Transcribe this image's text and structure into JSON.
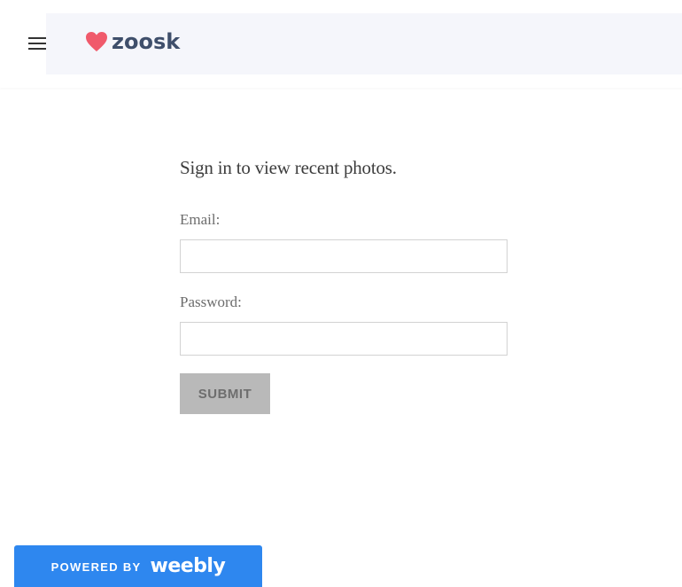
{
  "header": {
    "menu_icon": "hamburger-menu-icon",
    "logo": {
      "icon": "heart-icon",
      "text": "zoosk",
      "heart_color": "#f05a6b",
      "text_color": "#3f4f6b"
    }
  },
  "signin": {
    "title": "Sign in to view recent photos.",
    "email_label": "Email:",
    "email_value": "",
    "password_label": "Password:",
    "password_value": "",
    "submit_label": "SUBMIT"
  },
  "footer": {
    "badge_prefix": "POWERED BY",
    "badge_brand": "weebly",
    "badge_color": "#2e87ef"
  }
}
